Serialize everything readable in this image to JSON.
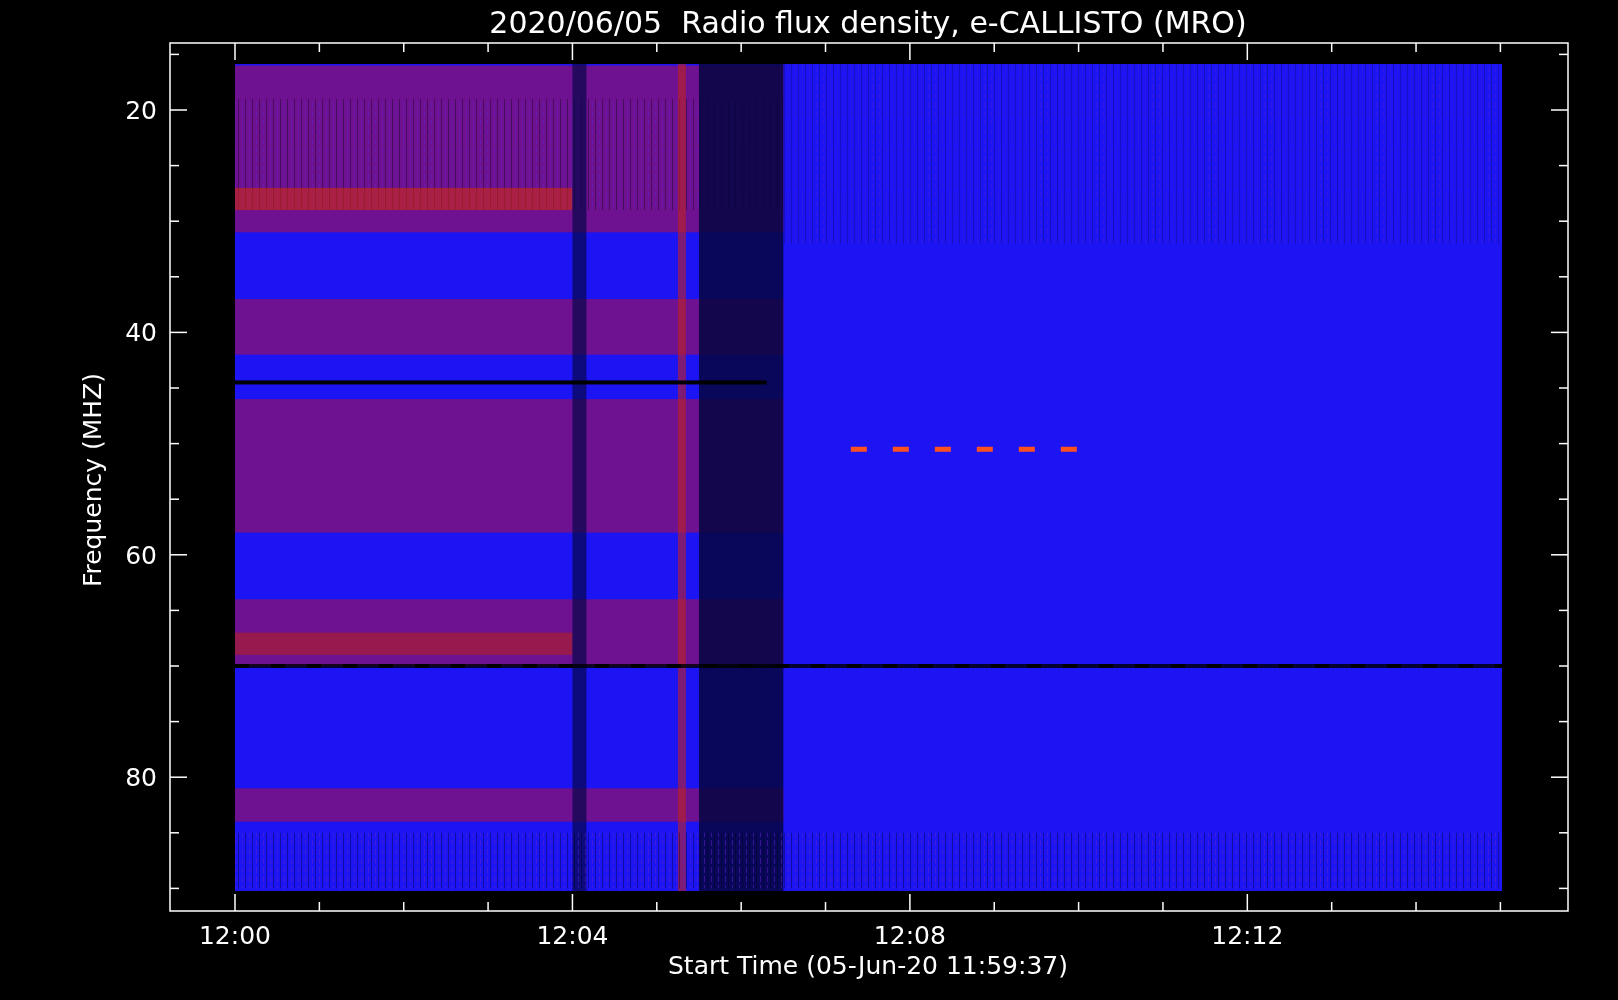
{
  "title": "2020/06/05  Radio flux density, e-CALLISTO (MRO)",
  "y_axis": {
    "label": "Frequency (MHZ)",
    "ticks": [
      "20",
      "40",
      "60",
      "80"
    ]
  },
  "x_axis": {
    "label": "Start Time (05-Jun-20 11:59:37)",
    "ticks": [
      "12:00",
      "12:04",
      "12:08",
      "12:12"
    ]
  }
}
